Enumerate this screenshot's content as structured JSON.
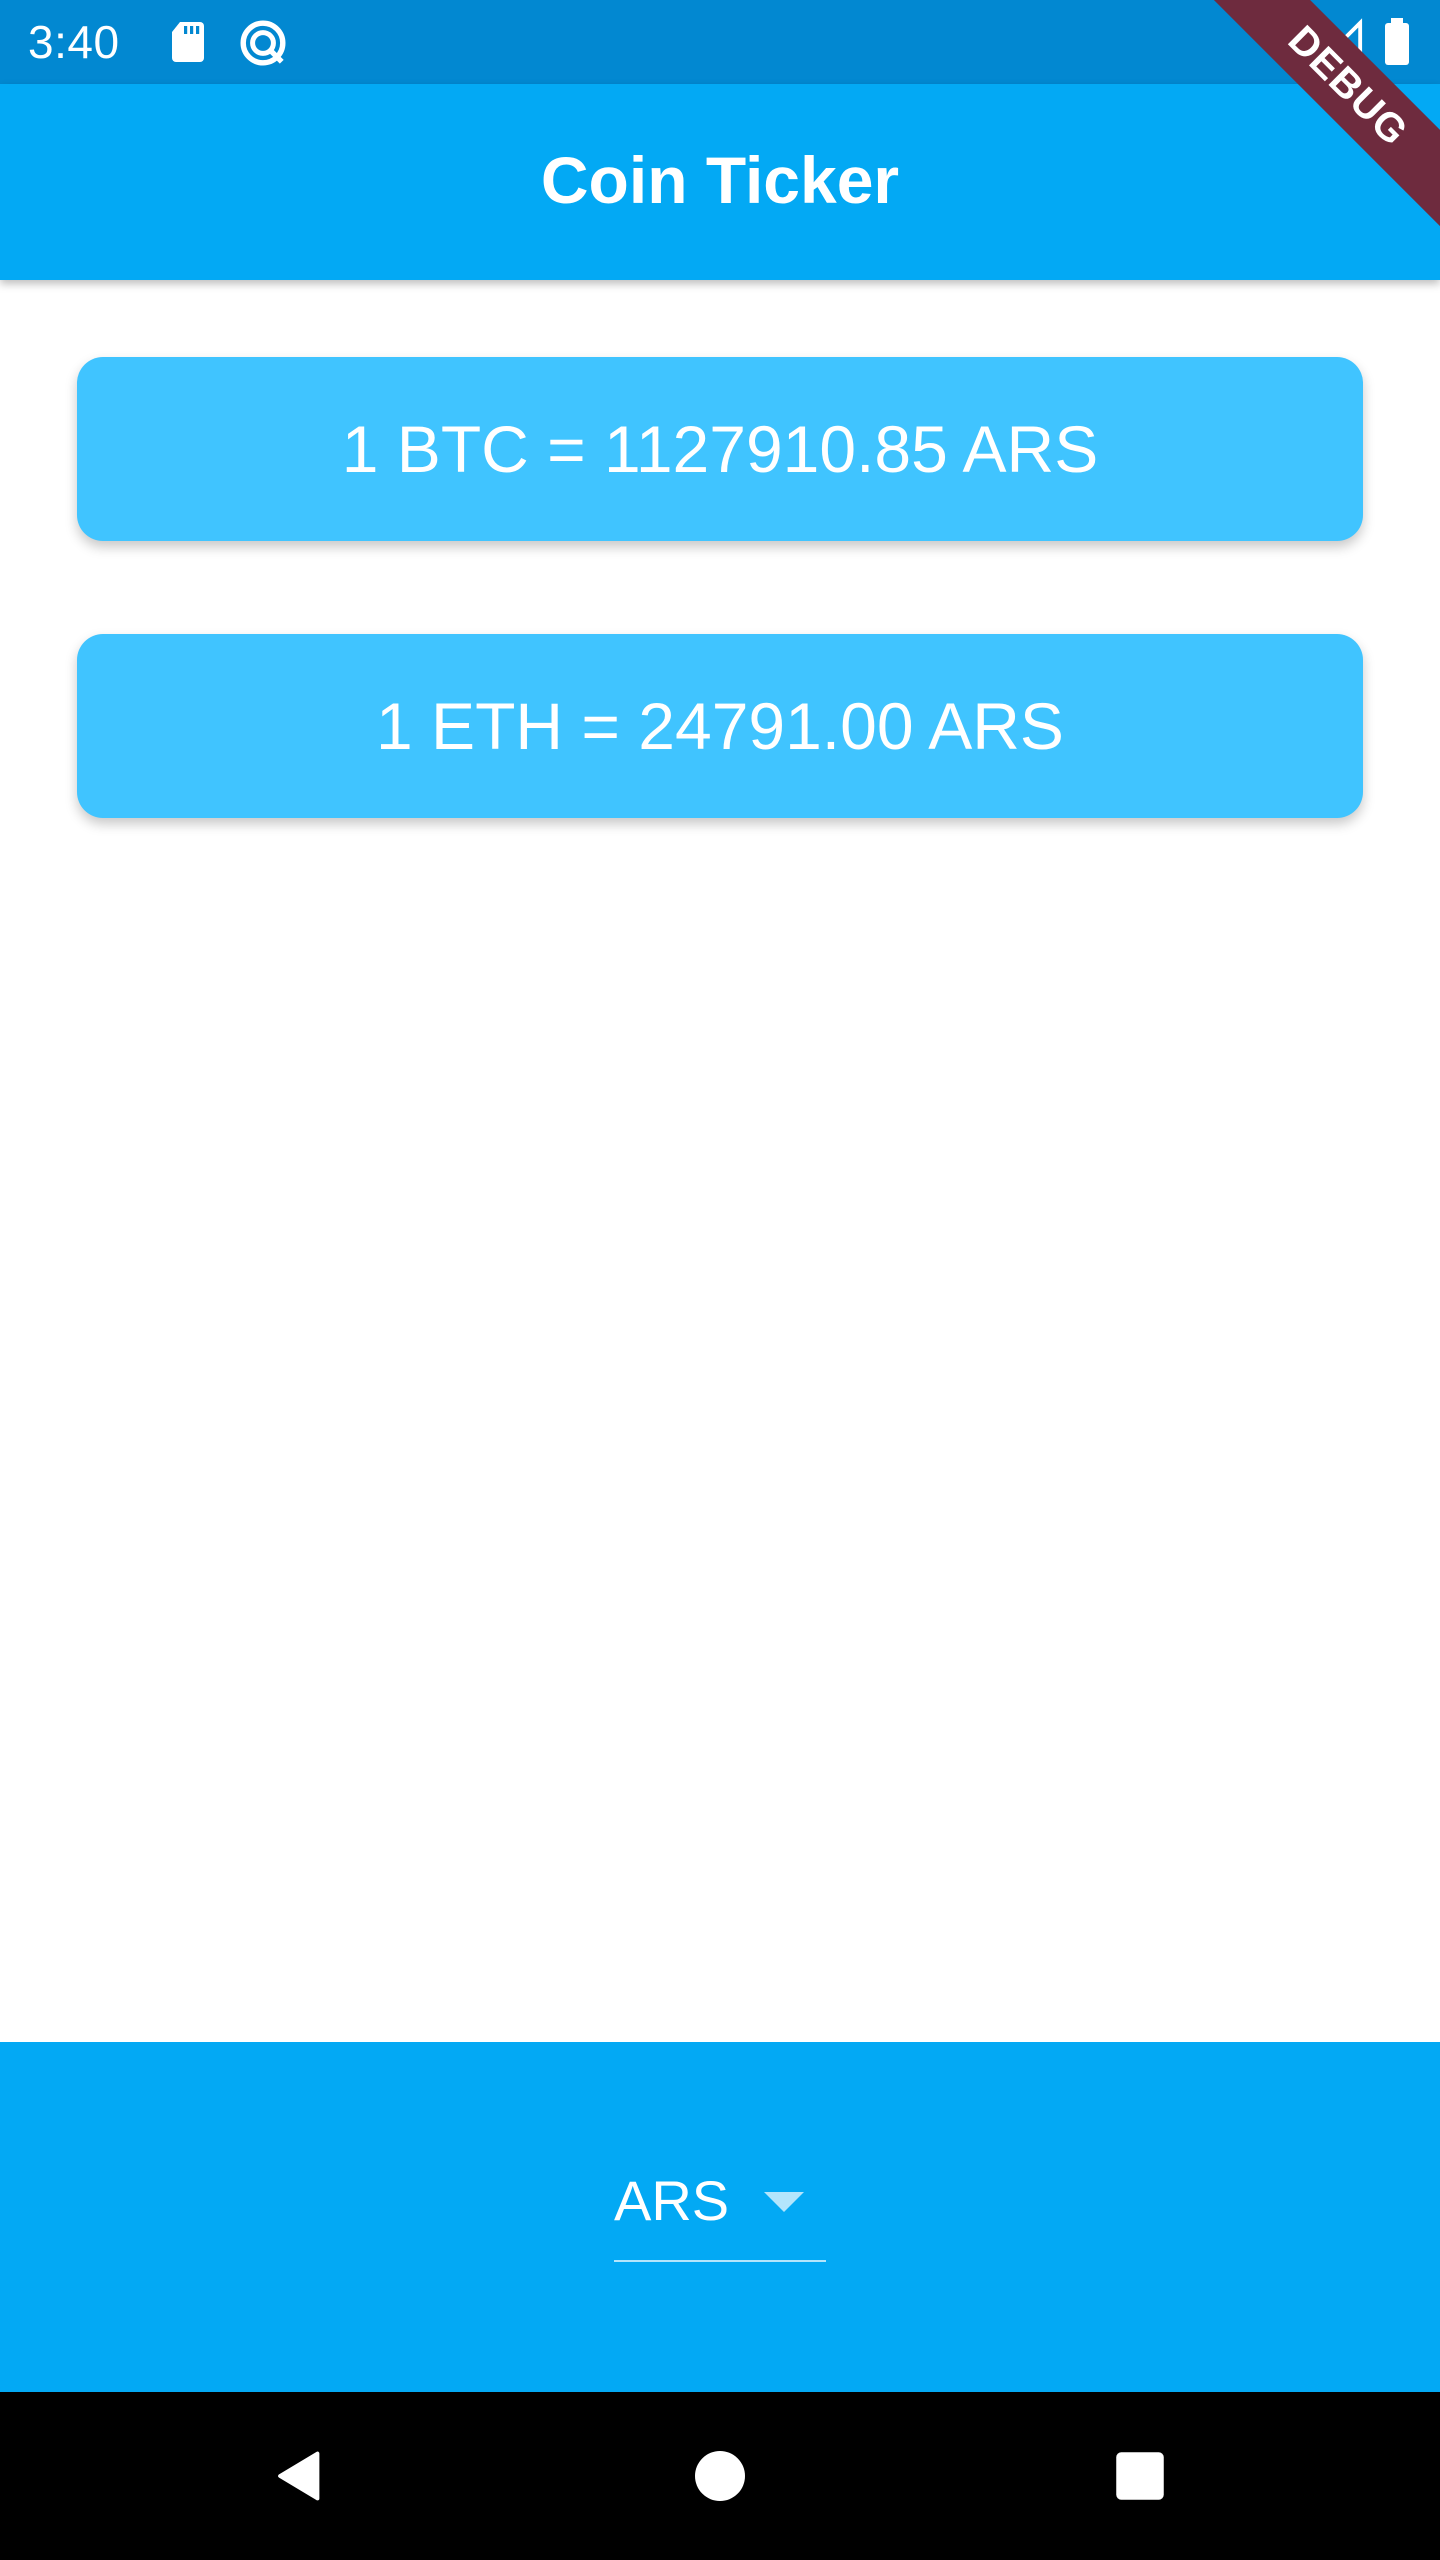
{
  "status_bar": {
    "time": "3:40",
    "icons": [
      "sd-card-icon",
      "sync-icon",
      "wifi-icon",
      "cell-signal-icon",
      "battery-icon"
    ]
  },
  "debug_banner": "DEBUG",
  "app_bar": {
    "title": "Coin Ticker"
  },
  "rates": [
    {
      "label": "1 BTC = 1127910.85 ARS"
    },
    {
      "label": "1 ETH = 24791.00 ARS"
    }
  ],
  "currency_picker": {
    "selected": "ARS"
  },
  "nav_bar": {
    "icons": [
      "back-icon",
      "home-icon",
      "recents-icon"
    ]
  },
  "colors": {
    "status_bar": "#0288d1",
    "app_bar": "#03a9f4",
    "card": "#40c4ff",
    "picker_background": "#03a9f4",
    "debug_banner": "#6e2b3e"
  }
}
